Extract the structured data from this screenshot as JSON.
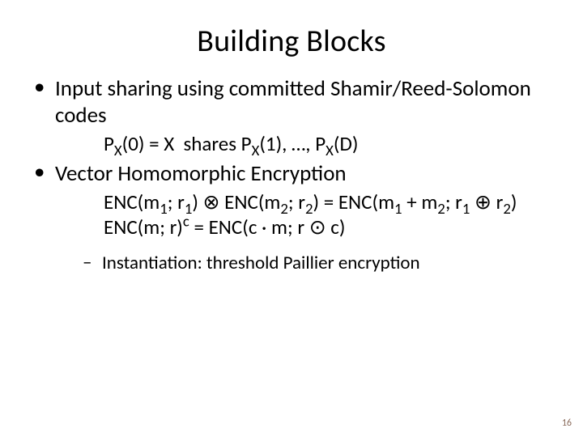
{
  "title": "Building Blocks",
  "bullets": {
    "item1": "Input sharing using committed Shamir/Reed-Solomon codes",
    "item1_sub_html": "P<span class=\"sub\">X</span>(0) = X&nbsp;&nbsp;shares P<span class=\"sub\">X</span>(1), …, P<span class=\"sub\">X</span>(D)",
    "item2": "Vector Homomorphic Encryption",
    "item2_sub_line1_html": "ENC(m<span class=\"sub\">1</span>; r<span class=\"sub\">1</span>) ⊗ ENC(m<span class=\"sub\">2</span>; r<span class=\"sub\">2</span>) = ENC(m<span class=\"sub\">1</span> + m<span class=\"sub\">2</span>; r<span class=\"sub\">1</span> ⊕ r<span class=\"sub\">2</span>)",
    "item2_sub_line2_html": "ENC(m; r)<span class=\"sup\">c</span> = ENC(c · m; r ⊙ c)",
    "item2_subbullet": "Instantiation: threshold Paillier encryption"
  },
  "page_number": "16"
}
